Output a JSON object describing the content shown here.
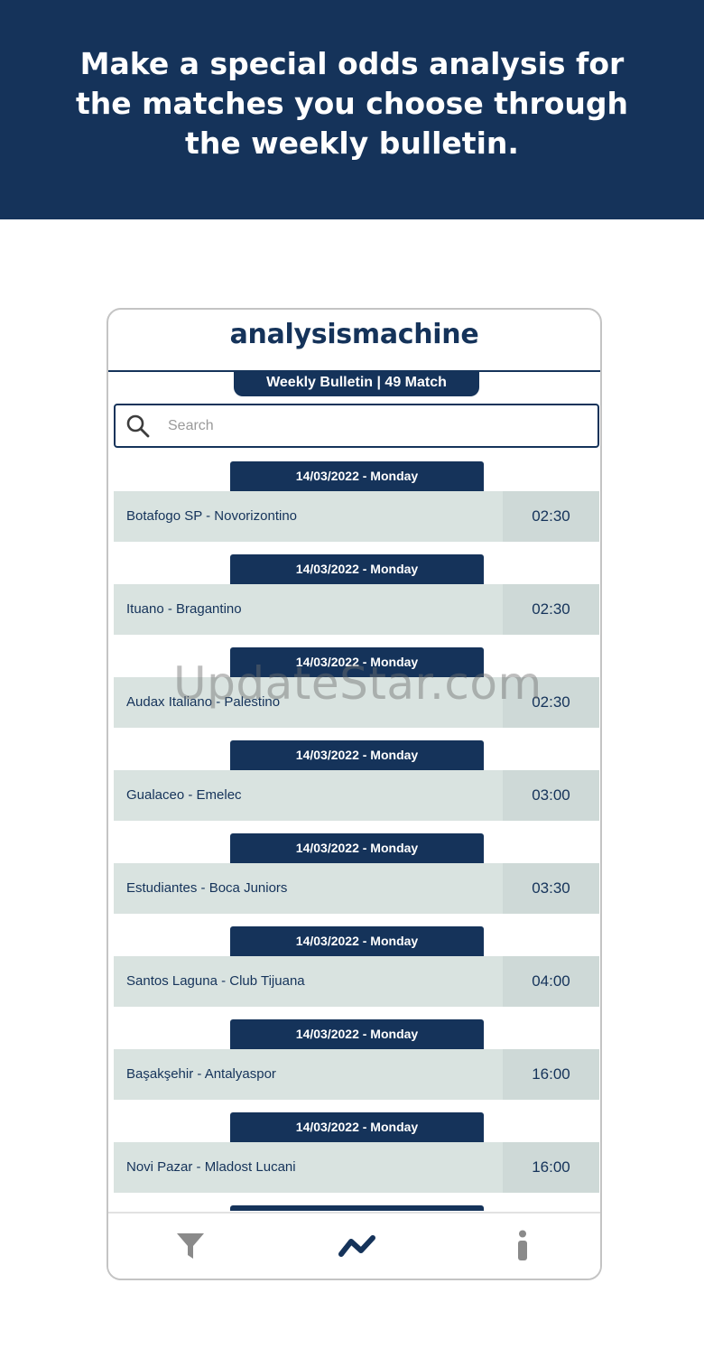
{
  "banner": {
    "headline": "Make a special odds analysis for the matches you choose through the weekly bulletin."
  },
  "app": {
    "title": "analysismachine",
    "bulletin_label": "Weekly Bulletin | 49 Match"
  },
  "search": {
    "placeholder": "Search",
    "value": ""
  },
  "matches": [
    {
      "date": "14/03/2022 - Monday",
      "teams": "Botafogo SP - Novorizontino",
      "time": "02:30"
    },
    {
      "date": "14/03/2022 - Monday",
      "teams": "Ituano - Bragantino",
      "time": "02:30"
    },
    {
      "date": "14/03/2022 - Monday",
      "teams": "Audax Italiano - Palestino",
      "time": "02:30"
    },
    {
      "date": "14/03/2022 - Monday",
      "teams": "Gualaceo - Emelec",
      "time": "03:00"
    },
    {
      "date": "14/03/2022 - Monday",
      "teams": "Estudiantes - Boca Juniors",
      "time": "03:30"
    },
    {
      "date": "14/03/2022 - Monday",
      "teams": "Santos Laguna - Club Tijuana",
      "time": "04:00"
    },
    {
      "date": "14/03/2022 - Monday",
      "teams": "Başakşehir - Antalyaspor",
      "time": "16:00"
    },
    {
      "date": "14/03/2022 - Monday",
      "teams": "Novi Pazar - Mladost Lucani",
      "time": "16:00"
    }
  ],
  "watermark": "UpdateStar.com",
  "nav": {
    "items": [
      {
        "icon": "filter-icon",
        "active": false
      },
      {
        "icon": "analysis-icon",
        "active": true
      },
      {
        "icon": "info-icon",
        "active": false
      }
    ]
  },
  "colors": {
    "primary": "#15335a",
    "row_bg": "#d9e3e0",
    "inactive_icon": "#8a8a8a"
  }
}
